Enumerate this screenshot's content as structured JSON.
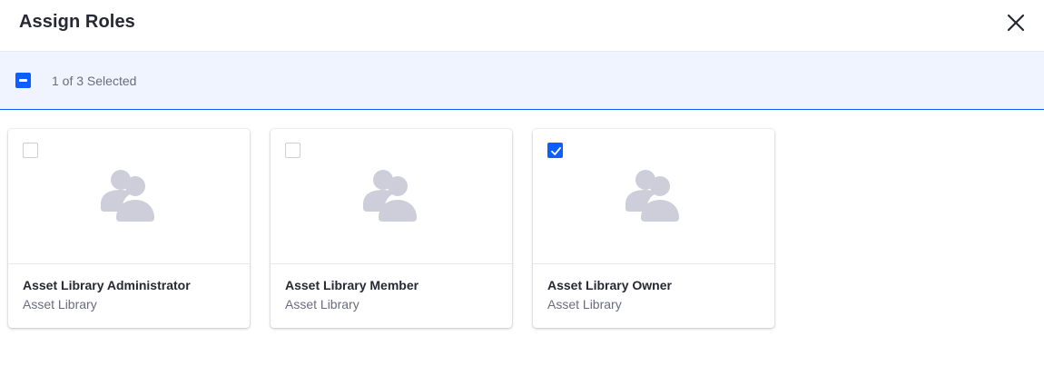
{
  "modal": {
    "title": "Assign Roles"
  },
  "management_bar": {
    "selection_text": "1 of 3 Selected"
  },
  "colors": {
    "primary": "#0b5fff",
    "bar_background": "#eff4fe",
    "icon_gray": "#cdced9"
  },
  "cards": [
    {
      "title": "Asset Library Administrator",
      "subtitle": "Asset Library",
      "checked": false,
      "icon": "users-icon"
    },
    {
      "title": "Asset Library Member",
      "subtitle": "Asset Library",
      "checked": false,
      "icon": "users-icon"
    },
    {
      "title": "Asset Library Owner",
      "subtitle": "Asset Library",
      "checked": true,
      "icon": "users-icon"
    }
  ]
}
